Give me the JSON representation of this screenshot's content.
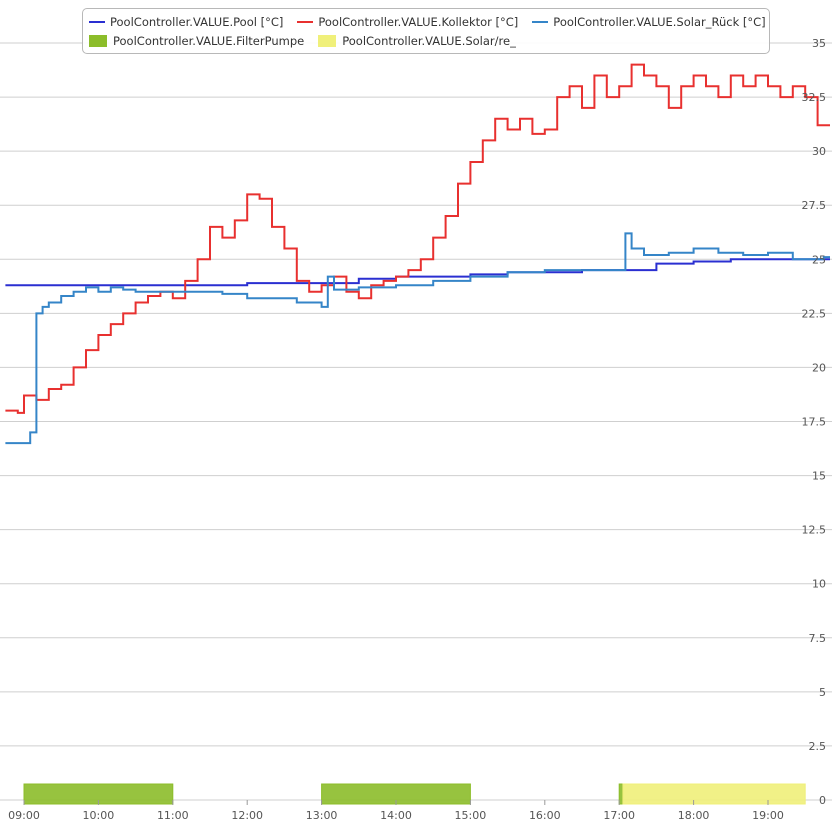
{
  "chart_data": {
    "type": "line",
    "title": "",
    "xlabel": "",
    "ylabel": "",
    "ylim": [
      0,
      35
    ],
    "xlim": [
      "08:45",
      "19:45"
    ],
    "grid": true,
    "legend_position": "top",
    "y_ticks": [
      "0",
      "2.5",
      "5",
      "7.5",
      "10",
      "12.5",
      "15",
      "17.5",
      "20",
      "22.5",
      "25",
      "27.5",
      "30",
      "32.5",
      "35"
    ],
    "x_ticks": [
      "09:00",
      "10:00",
      "11:00",
      "12:00",
      "13:00",
      "14:00",
      "15:00",
      "16:00",
      "17:00",
      "18:00",
      "19:00"
    ],
    "series": [
      {
        "name": "PoolController.VALUE.Pool [°C]",
        "color": "#2a2fd1",
        "kind": "step-line",
        "x": [
          "08:45",
          "10:00",
          "11:00",
          "12:00",
          "13:00",
          "13:30",
          "14:00",
          "14:30",
          "15:00",
          "15:30",
          "16:00",
          "16:30",
          "17:00",
          "17:30",
          "18:00",
          "18:30",
          "19:00",
          "19:45"
        ],
        "values": [
          23.8,
          23.8,
          23.8,
          23.9,
          23.9,
          24.1,
          24.2,
          24.2,
          24.3,
          24.4,
          24.4,
          24.5,
          24.5,
          24.8,
          24.9,
          25.0,
          25.0,
          25.0
        ]
      },
      {
        "name": "PoolController.VALUE.Kollektor [°C]",
        "color": "#e8302f",
        "kind": "step-line",
        "x": [
          "08:45",
          "08:55",
          "09:00",
          "09:10",
          "09:20",
          "09:30",
          "09:40",
          "09:50",
          "10:00",
          "10:10",
          "10:20",
          "10:30",
          "10:40",
          "10:50",
          "11:00",
          "11:10",
          "11:20",
          "11:30",
          "11:40",
          "11:50",
          "12:00",
          "12:10",
          "12:20",
          "12:30",
          "12:40",
          "12:50",
          "13:00",
          "13:10",
          "13:20",
          "13:30",
          "13:40",
          "13:50",
          "14:00",
          "14:10",
          "14:20",
          "14:30",
          "14:40",
          "14:50",
          "15:00",
          "15:10",
          "15:20",
          "15:30",
          "15:40",
          "15:50",
          "16:00",
          "16:10",
          "16:20",
          "16:30",
          "16:40",
          "16:50",
          "17:00",
          "17:10",
          "17:20",
          "17:30",
          "17:40",
          "17:50",
          "18:00",
          "18:10",
          "18:20",
          "18:30",
          "18:40",
          "18:50",
          "19:00",
          "19:10",
          "19:20",
          "19:30",
          "19:40"
        ],
        "values": [
          18.0,
          17.9,
          18.7,
          18.5,
          19.0,
          19.2,
          20.0,
          20.8,
          21.5,
          22.0,
          22.5,
          23.0,
          23.3,
          23.5,
          23.2,
          24.0,
          25.0,
          26.5,
          26.0,
          26.8,
          28.0,
          27.8,
          26.5,
          25.5,
          24.0,
          23.5,
          23.8,
          24.2,
          23.5,
          23.2,
          23.8,
          24.0,
          24.2,
          24.5,
          25.0,
          26.0,
          27.0,
          28.5,
          29.5,
          30.5,
          31.5,
          31.0,
          31.5,
          30.8,
          31.0,
          32.5,
          33.0,
          32.0,
          33.5,
          32.5,
          33.0,
          34.0,
          33.5,
          33.0,
          32.0,
          33.0,
          33.5,
          33.0,
          32.5,
          33.5,
          33.0,
          33.5,
          33.0,
          32.5,
          33.0,
          32.5,
          31.2
        ]
      },
      {
        "name": "PoolController.VALUE.Solar_Rück [°C]",
        "color": "#3585c8",
        "kind": "step-line",
        "x": [
          "08:45",
          "09:05",
          "09:10",
          "09:15",
          "09:20",
          "09:30",
          "09:40",
          "09:50",
          "10:00",
          "10:10",
          "10:20",
          "10:30",
          "11:00",
          "11:20",
          "11:40",
          "12:00",
          "12:20",
          "12:40",
          "13:00",
          "13:05",
          "13:10",
          "13:30",
          "14:00",
          "14:30",
          "15:00",
          "15:30",
          "16:00",
          "16:30",
          "17:00",
          "17:05",
          "17:10",
          "17:20",
          "17:40",
          "18:00",
          "18:20",
          "18:40",
          "19:00",
          "19:20",
          "19:45"
        ],
        "values": [
          16.5,
          17.0,
          22.5,
          22.8,
          23.0,
          23.3,
          23.5,
          23.7,
          23.5,
          23.7,
          23.6,
          23.5,
          23.5,
          23.5,
          23.4,
          23.2,
          23.2,
          23.0,
          22.8,
          24.2,
          23.6,
          23.7,
          23.8,
          24.0,
          24.2,
          24.4,
          24.5,
          24.5,
          24.5,
          26.2,
          25.5,
          25.2,
          25.3,
          25.5,
          25.3,
          25.2,
          25.3,
          25.0,
          25.1
        ]
      },
      {
        "name": "PoolController.VALUE.FilterPumpe",
        "color": "#8cbd2a",
        "kind": "bar-band",
        "intervals": [
          [
            "09:00",
            "11:00"
          ],
          [
            "13:00",
            "15:00"
          ],
          [
            "17:00",
            "17:03"
          ]
        ]
      },
      {
        "name": "PoolController.VALUE.Solar/re_",
        "color": "#f0f07a",
        "kind": "bar-band",
        "intervals": [
          [
            "17:03",
            "19:30"
          ]
        ]
      }
    ]
  }
}
